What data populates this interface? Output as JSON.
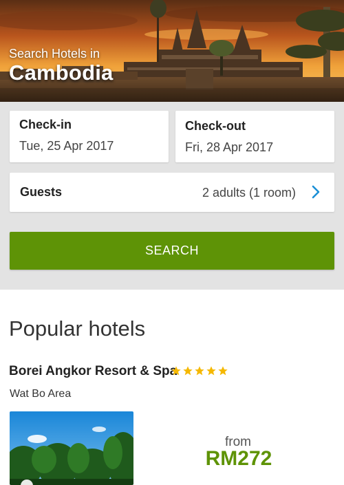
{
  "hero": {
    "subtitle": "Search Hotels in",
    "title": "Cambodia"
  },
  "search_form": {
    "checkin": {
      "label": "Check-in",
      "value": "Tue, 25 Apr 2017"
    },
    "checkout": {
      "label": "Check-out",
      "value": "Fri, 28 Apr 2017"
    },
    "guests": {
      "label": "Guests",
      "value": "2 adults (1 room)",
      "icon": "chevron-right-icon"
    },
    "search_button": "SEARCH"
  },
  "popular": {
    "title": "Popular hotels",
    "hotels": [
      {
        "name": "Borei Angkor Resort & Spa",
        "stars": 5,
        "area": "Wat Bo Area",
        "price_prefix": "from",
        "price": "RM272"
      }
    ]
  },
  "colors": {
    "accent_green": "#5e9306",
    "form_background": "#e3e3e3",
    "star_yellow": "#f5b800",
    "chevron_blue": "#1a8fd6"
  }
}
